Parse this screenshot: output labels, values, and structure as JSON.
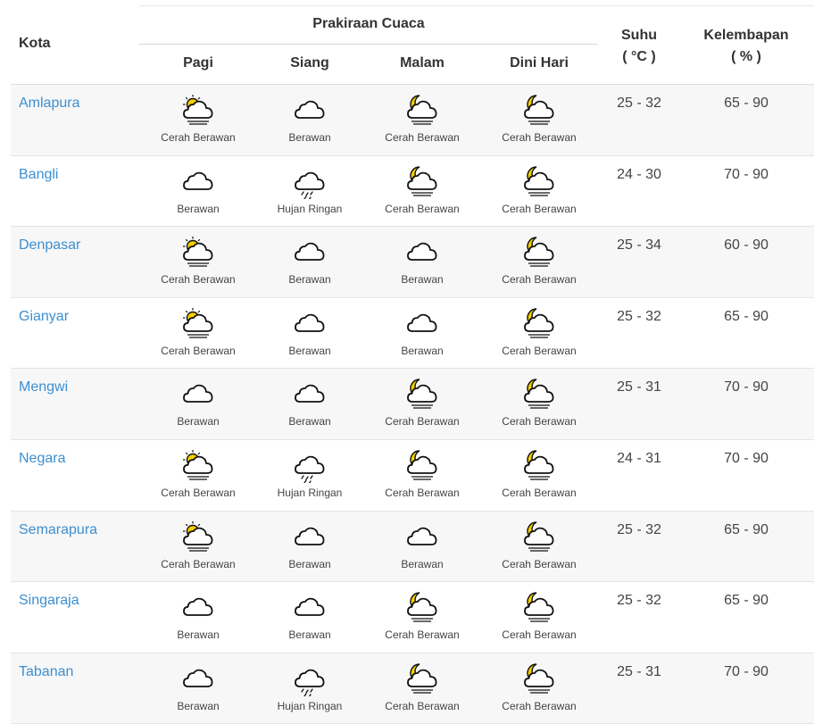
{
  "header": {
    "kota": "Kota",
    "prakiraan": "Prakiraan Cuaca",
    "periods": [
      "Pagi",
      "Siang",
      "Malam",
      "Dini Hari"
    ],
    "suhu": "Suhu",
    "suhu_unit": "( °C )",
    "kelembapan": "Kelembapan",
    "kelembapan_unit": "( % )"
  },
  "colors": {
    "link": "#3b8fd1",
    "sun": "#f5d000",
    "moon": "#f5d000"
  },
  "rows": [
    {
      "city": "Amlapura",
      "w": [
        {
          "icon": "sun-cloud-icon",
          "label": "Cerah Berawan"
        },
        {
          "icon": "cloud-icon",
          "label": "Berawan"
        },
        {
          "icon": "moon-cloud-icon",
          "label": "Cerah Berawan"
        },
        {
          "icon": "moon-cloud-icon",
          "label": "Cerah Berawan"
        }
      ],
      "suhu": "25 - 32",
      "kelembapan": "65 - 90"
    },
    {
      "city": "Bangli",
      "w": [
        {
          "icon": "cloud-icon",
          "label": "Berawan"
        },
        {
          "icon": "rain-cloud-icon",
          "label": "Hujan Ringan"
        },
        {
          "icon": "moon-cloud-icon",
          "label": "Cerah Berawan"
        },
        {
          "icon": "moon-cloud-icon",
          "label": "Cerah Berawan"
        }
      ],
      "suhu": "24 - 30",
      "kelembapan": "70 - 90"
    },
    {
      "city": "Denpasar",
      "w": [
        {
          "icon": "sun-cloud-icon",
          "label": "Cerah Berawan"
        },
        {
          "icon": "cloud-icon",
          "label": "Berawan"
        },
        {
          "icon": "cloud-icon",
          "label": "Berawan"
        },
        {
          "icon": "moon-cloud-icon",
          "label": "Cerah Berawan"
        }
      ],
      "suhu": "25 - 34",
      "kelembapan": "60 - 90"
    },
    {
      "city": "Gianyar",
      "w": [
        {
          "icon": "sun-cloud-icon",
          "label": "Cerah Berawan"
        },
        {
          "icon": "cloud-icon",
          "label": "Berawan"
        },
        {
          "icon": "cloud-icon",
          "label": "Berawan"
        },
        {
          "icon": "moon-cloud-icon",
          "label": "Cerah Berawan"
        }
      ],
      "suhu": "25 - 32",
      "kelembapan": "65 - 90"
    },
    {
      "city": "Mengwi",
      "w": [
        {
          "icon": "cloud-icon",
          "label": "Berawan"
        },
        {
          "icon": "cloud-icon",
          "label": "Berawan"
        },
        {
          "icon": "moon-cloud-icon",
          "label": "Cerah Berawan"
        },
        {
          "icon": "moon-cloud-icon",
          "label": "Cerah Berawan"
        }
      ],
      "suhu": "25 - 31",
      "kelembapan": "70 - 90"
    },
    {
      "city": "Negara",
      "w": [
        {
          "icon": "sun-cloud-icon",
          "label": "Cerah Berawan"
        },
        {
          "icon": "rain-cloud-icon",
          "label": "Hujan Ringan"
        },
        {
          "icon": "moon-cloud-icon",
          "label": "Cerah Berawan"
        },
        {
          "icon": "moon-cloud-icon",
          "label": "Cerah Berawan"
        }
      ],
      "suhu": "24 - 31",
      "kelembapan": "70 - 90"
    },
    {
      "city": "Semarapura",
      "w": [
        {
          "icon": "sun-cloud-icon",
          "label": "Cerah Berawan"
        },
        {
          "icon": "cloud-icon",
          "label": "Berawan"
        },
        {
          "icon": "cloud-icon",
          "label": "Berawan"
        },
        {
          "icon": "moon-cloud-icon",
          "label": "Cerah Berawan"
        }
      ],
      "suhu": "25 - 32",
      "kelembapan": "65 - 90"
    },
    {
      "city": "Singaraja",
      "w": [
        {
          "icon": "cloud-icon",
          "label": "Berawan"
        },
        {
          "icon": "cloud-icon",
          "label": "Berawan"
        },
        {
          "icon": "moon-cloud-icon",
          "label": "Cerah Berawan"
        },
        {
          "icon": "moon-cloud-icon",
          "label": "Cerah Berawan"
        }
      ],
      "suhu": "25 - 32",
      "kelembapan": "65 - 90"
    },
    {
      "city": "Tabanan",
      "w": [
        {
          "icon": "cloud-icon",
          "label": "Berawan"
        },
        {
          "icon": "rain-cloud-icon",
          "label": "Hujan Ringan"
        },
        {
          "icon": "moon-cloud-icon",
          "label": "Cerah Berawan"
        },
        {
          "icon": "moon-cloud-icon",
          "label": "Cerah Berawan"
        }
      ],
      "suhu": "25 - 31",
      "kelembapan": "70 - 90"
    }
  ]
}
